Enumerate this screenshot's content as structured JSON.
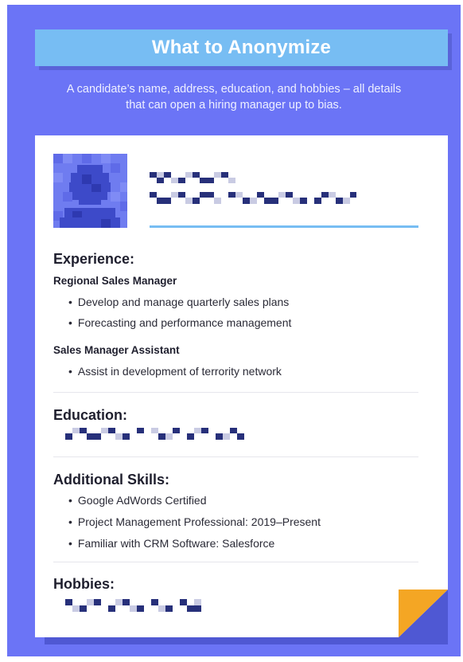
{
  "header": {
    "title": "What to Anonymize",
    "subtitle": "A candidate’s name, address, education, and hobbies – all details that can open a hiring manager up to bias."
  },
  "resume": {
    "experience": {
      "heading": "Experience:",
      "roles": [
        {
          "title": "Regional Sales Manager",
          "bullets": [
            "Develop and manage quarterly sales plans",
            "Forecasting and performance management"
          ]
        },
        {
          "title": "Sales Manager Assistant",
          "bullets": [
            "Assist in development of terrority network"
          ]
        }
      ]
    },
    "education": {
      "heading": "Education:"
    },
    "skills": {
      "heading": "Additional Skills:",
      "items": [
        "Google AdWords Certified",
        "Project Management Professional: 2019–Present",
        "Familiar with CRM Software: Salesforce"
      ]
    },
    "hobbies": {
      "heading": "Hobbies:"
    }
  },
  "colors": {
    "background": "#6b74f6",
    "banner": "#77bdf3",
    "fold": "#f4a624",
    "pixel_dark": "#27307a",
    "pixel_light": "#c9cbe3"
  }
}
